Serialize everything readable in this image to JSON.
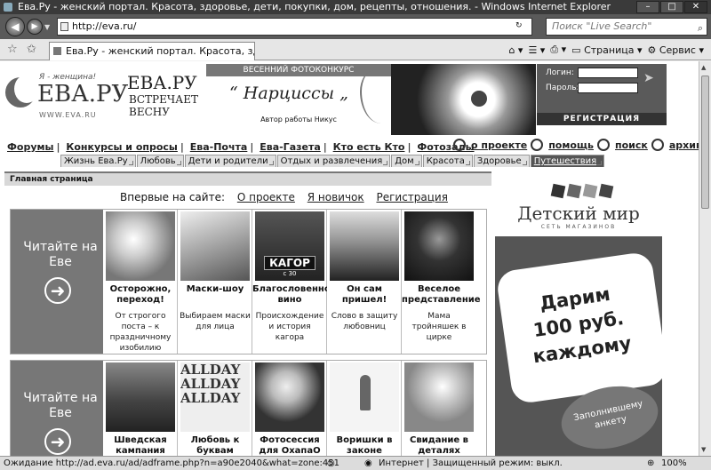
{
  "window": {
    "title": "Ева.Ру - женский портал. Красота, здоровье, дети, покупки, дом, рецепты, отношения. - Windows Internet Explorer"
  },
  "address": {
    "url": "http://eva.ru/"
  },
  "search": {
    "placeholder": "Поиск \"Live Search\""
  },
  "tab": {
    "label": "Ева.Ру - женский портал. Красота, здоровье, де..."
  },
  "commands": {
    "page": "Страница",
    "tools": "Сервис"
  },
  "header": {
    "logo_tag": "Я - женщина!",
    "logo_brand": "ЕВА.РУ",
    "logo_url": "WWW.EVA.RU",
    "slogan_title": "ЕВА.РУ",
    "slogan_line1": "ВСТРЕЧАЕТ",
    "slogan_line2": "ВЕСНУ",
    "contest_label": "ВЕСЕННИЙ ФОТОКОНКУРС",
    "contest_quote": "“ Нарциссы „",
    "contest_author": "Автор работы Никус",
    "login_label": "Логин:",
    "password_label": "Пароль:",
    "register": "РЕГИСТРАЦИЯ"
  },
  "nav": {
    "main": [
      "Форумы",
      "Конкурсы и опросы",
      "Ева-Почта",
      "Ева-Газета",
      "Кто есть Кто",
      "Фотозалы"
    ],
    "right": [
      "о проекте",
      "помощь",
      "поиск",
      "архив"
    ]
  },
  "categories": [
    "Жизнь Ева.Ру",
    "Любовь",
    "Дети и родители",
    "Отдых и развлечения",
    "Дом",
    "Красота",
    "Здоровье",
    "Путешествия"
  ],
  "content": {
    "breadcrumb": "Главная страница",
    "first_time": "Впервые на сайте:",
    "first_links": [
      "О проекте",
      "Я новичок",
      "Регистрация"
    ],
    "read_label": "Читайте на Еве",
    "row1": [
      {
        "title": "Осторожно, переход!",
        "sub": "От строгого поста – к праздничному изобилию"
      },
      {
        "title": "Маски-шоу",
        "sub": "Выбираем маски для лица"
      },
      {
        "title": "Благословенное вино",
        "sub": "Происхождение и история кагора"
      },
      {
        "title": "Он сам пришел!",
        "sub": "Слово в защиту любовниц"
      },
      {
        "title": "Веселое представление",
        "sub": "Мама тройняшек в цирке"
      }
    ],
    "kagor_label": "КАГОР",
    "kagor_sub": "с 30",
    "alldays": "ALLDAY",
    "row2": [
      {
        "title": "Шведская кампания"
      },
      {
        "title": "Любовь к буквам"
      },
      {
        "title": "Фотосессия для ОхапаО"
      },
      {
        "title": "Воришки в законе"
      },
      {
        "title": "Свидание в деталях"
      }
    ]
  },
  "ad": {
    "brand": "Детский мир",
    "brand_sub": "СЕТЬ МАГАЗИНОВ",
    "offer_line1": "Дарим",
    "offer_line2": "100 руб.",
    "offer_line3": "каждому",
    "note_line1": "Заполнившему",
    "note_line2": "анкету"
  },
  "status": {
    "loading": "Ожидание http://ad.eva.ru/ad/adframe.php?n=a90e2040&what=zone:451",
    "zone": "Интернет | Защищенный режим: выкл.",
    "zoom": "100%"
  }
}
